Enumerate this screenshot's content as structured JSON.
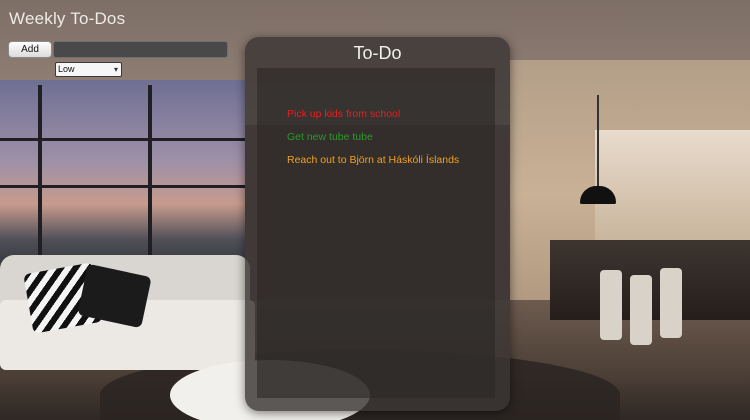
{
  "app": {
    "title": "Weekly To-Dos"
  },
  "form": {
    "add_label": "Add",
    "task_value": "",
    "task_placeholder": "",
    "priority_selected": "Low"
  },
  "panel": {
    "title": "To-Do",
    "items": [
      {
        "text": "Pick up kids from school",
        "color": "#e32020"
      },
      {
        "text": "Get new tube tube",
        "color": "#2a9a2a"
      },
      {
        "text": "Reach out to Björn at Háskóli Íslands",
        "color": "#f0a020"
      }
    ]
  },
  "icons": {
    "select_chevron": "chevron-down-icon"
  }
}
